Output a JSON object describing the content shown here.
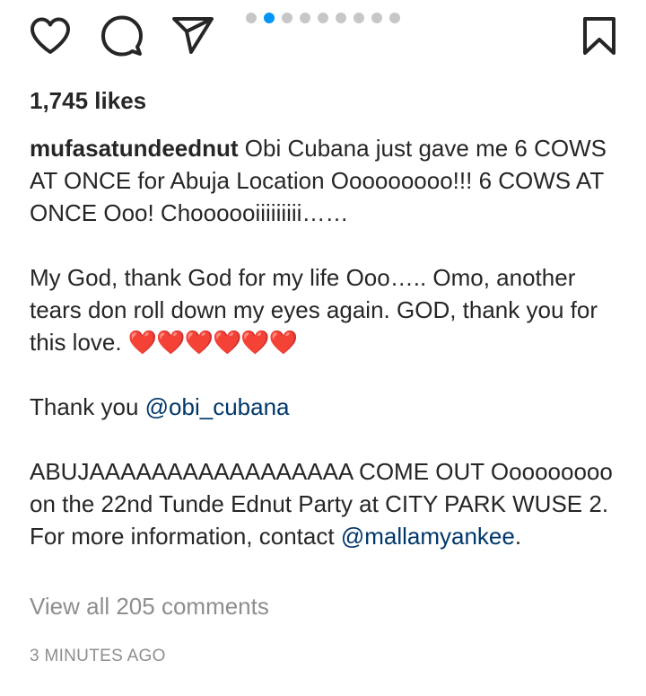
{
  "actions": {
    "like_icon": "heart-outline",
    "comment_icon": "speech-bubble",
    "share_icon": "paper-plane",
    "save_icon": "bookmark-outline"
  },
  "carousel": {
    "total": 9,
    "active_index": 1,
    "active_color": "#0095f6",
    "inactive_color": "#c7c7c7"
  },
  "post": {
    "likes_label": "1,745 likes",
    "username": "mufasatundeednut",
    "caption_line1": " Obi Cubana just gave me 6 COWS AT ONCE for Abuja Location Ooooooooo!!! 6 COWS AT ONCE Ooo! Chooooоiiiiiiiii……",
    "caption_line2": "My God, thank God for my life Ooo….. Omo, another tears don roll down my eyes again. GOD, thank you for this love. ",
    "hearts": "❤️❤️❤️❤️❤️❤️",
    "thanks_prefix": "Thank you ",
    "thanks_mention": "@obi_cubana",
    "announcement": "ABUJAAAAAAAAAAAAAAAAA COME OUT Ooooooooo on the 22nd Tunde Ednut Party at CITY PARK WUSE 2. For more information, contact ",
    "contact_mention": "@mallamyankee",
    "contact_suffix": ".",
    "view_comments_label": "View all 205 comments",
    "timestamp": "3 MINUTES AGO"
  }
}
